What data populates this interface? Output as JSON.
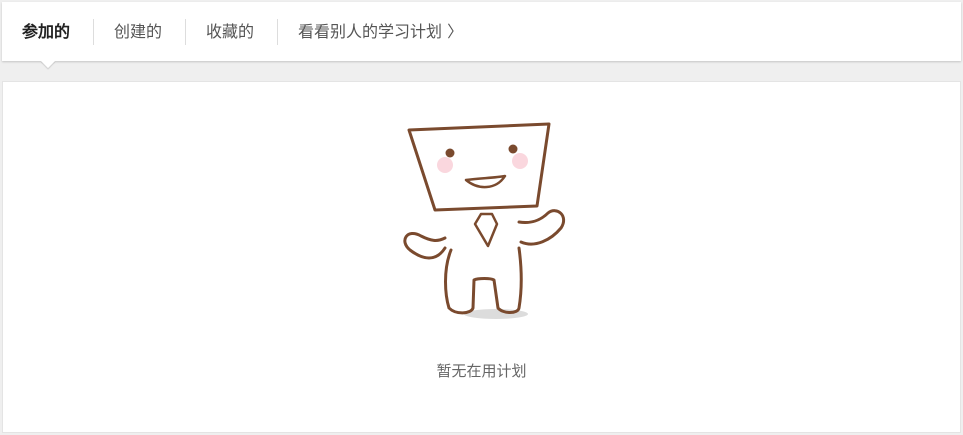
{
  "tabs": [
    {
      "label": "参加的",
      "active": true
    },
    {
      "label": "创建的",
      "active": false
    },
    {
      "label": "收藏的",
      "active": false
    }
  ],
  "others_link": {
    "label": "看看别人的学习计划",
    "chevron": "〉"
  },
  "empty_state": {
    "message": "暂无在用计划",
    "illustration_icon": "box-head-mascot-icon"
  },
  "colors": {
    "page_bg": "#efefef",
    "panel_bg": "#ffffff",
    "active_text": "#222222",
    "text": "#555555",
    "mascot_line": "#7a4a2e"
  }
}
